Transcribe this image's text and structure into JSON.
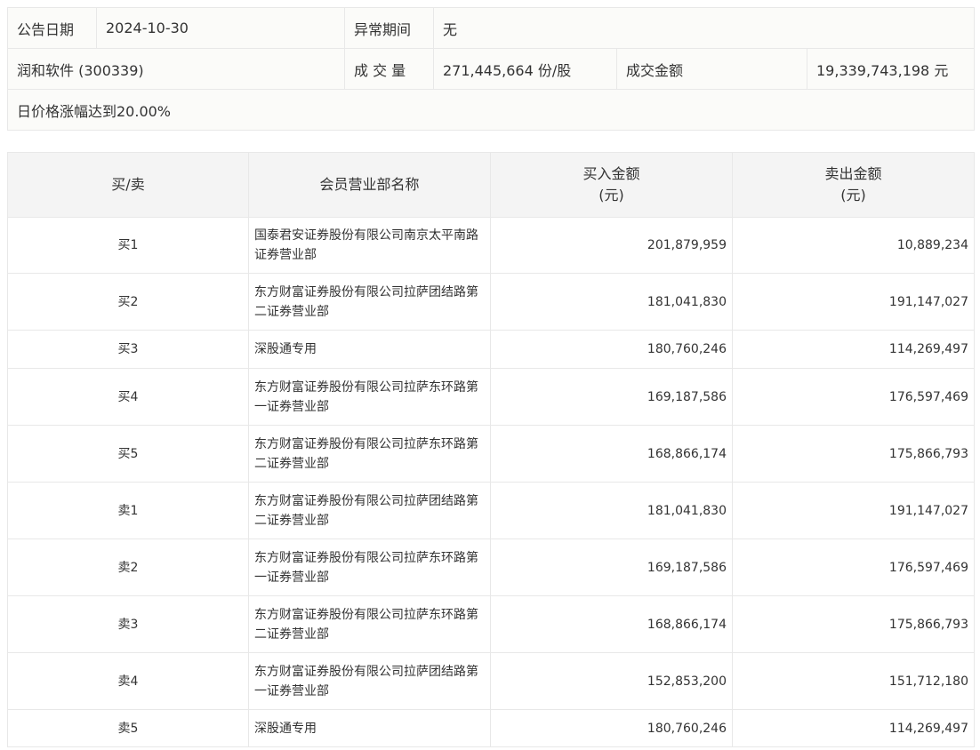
{
  "info": {
    "date_label": "公告日期",
    "date": "2024-10-30",
    "period_label": "异常期间",
    "period": "无",
    "stock": "润和软件 (300339)",
    "volume_label": "成 交 量",
    "volume": "271,445,664 份/股",
    "amount_label": "成交金额",
    "amount": "19,339,743,198 元",
    "reason": "日价格涨幅达到20.00%"
  },
  "table": {
    "headers": [
      "买/卖",
      "会员营业部名称",
      "买入金额",
      "(元)",
      "卖出金额",
      "(元)"
    ],
    "rows": [
      {
        "side": "买1",
        "name": "国泰君安证券股份有限公司南京太平南路证券营业部",
        "buy": "201,879,959",
        "sell": "10,889,234"
      },
      {
        "side": "买2",
        "name": "东方财富证券股份有限公司拉萨团结路第二证券营业部",
        "buy": "181,041,830",
        "sell": "191,147,027"
      },
      {
        "side": "买3",
        "name": "深股通专用",
        "buy": "180,760,246",
        "sell": "114,269,497"
      },
      {
        "side": "买4",
        "name": "东方财富证券股份有限公司拉萨东环路第一证券营业部",
        "buy": "169,187,586",
        "sell": "176,597,469"
      },
      {
        "side": "买5",
        "name": "东方财富证券股份有限公司拉萨东环路第二证券营业部",
        "buy": "168,866,174",
        "sell": "175,866,793"
      },
      {
        "side": "卖1",
        "name": "东方财富证券股份有限公司拉萨团结路第二证券营业部",
        "buy": "181,041,830",
        "sell": "191,147,027"
      },
      {
        "side": "卖2",
        "name": "东方财富证券股份有限公司拉萨东环路第一证券营业部",
        "buy": "169,187,586",
        "sell": "176,597,469"
      },
      {
        "side": "卖3",
        "name": "东方财富证券股份有限公司拉萨东环路第二证券营业部",
        "buy": "168,866,174",
        "sell": "175,866,793"
      },
      {
        "side": "卖4",
        "name": "东方财富证券股份有限公司拉萨团结路第一证券营业部",
        "buy": "152,853,200",
        "sell": "151,712,180"
      },
      {
        "side": "卖5",
        "name": "深股通专用",
        "buy": "180,760,246",
        "sell": "114,269,497"
      }
    ]
  }
}
